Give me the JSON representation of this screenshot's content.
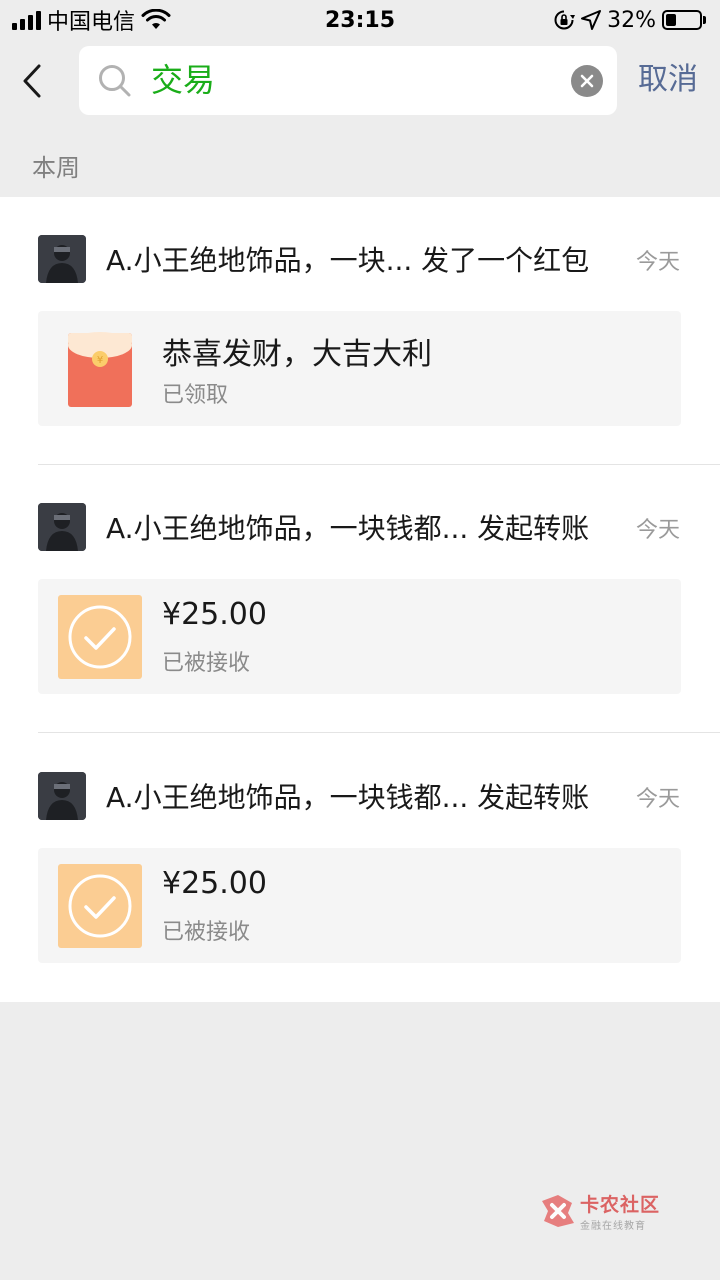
{
  "status_bar": {
    "carrier": "中国电信",
    "time": "23:15",
    "battery": "32%",
    "battery_level": 0.32
  },
  "search": {
    "query": "交易",
    "cancel_label": "取消"
  },
  "section_title": "本周",
  "entries": [
    {
      "title": "A.小王绝地饰品，一块... 发了一个红包",
      "date": "今天",
      "card_type": "red-packet",
      "card_main": "恭喜发财，大吉大利",
      "card_sub": "已领取"
    },
    {
      "title": "A.小王绝地饰品，一块钱都... 发起转账",
      "date": "今天",
      "card_type": "transfer",
      "card_main": "¥25.00",
      "card_sub": "已被接收"
    },
    {
      "title": "A.小王绝地饰品，一块钱都... 发起转账",
      "date": "今天",
      "card_type": "transfer",
      "card_main": "¥25.00",
      "card_sub": "已被接收"
    }
  ],
  "watermark": {
    "name": "卡农社区",
    "tagline": "金融在线教育"
  },
  "colors": {
    "accent_green": "#1aad19",
    "link_blue": "#576b95",
    "red_packet": "#f0705a",
    "transfer_orange": "#fbcd93"
  },
  "icons": [
    "signal-icon",
    "wifi-icon",
    "rotation-lock-icon",
    "location-icon",
    "battery-icon",
    "back-icon",
    "search-icon",
    "clear-icon",
    "red-packet-icon",
    "transfer-check-icon",
    "kanong-logo-icon"
  ]
}
